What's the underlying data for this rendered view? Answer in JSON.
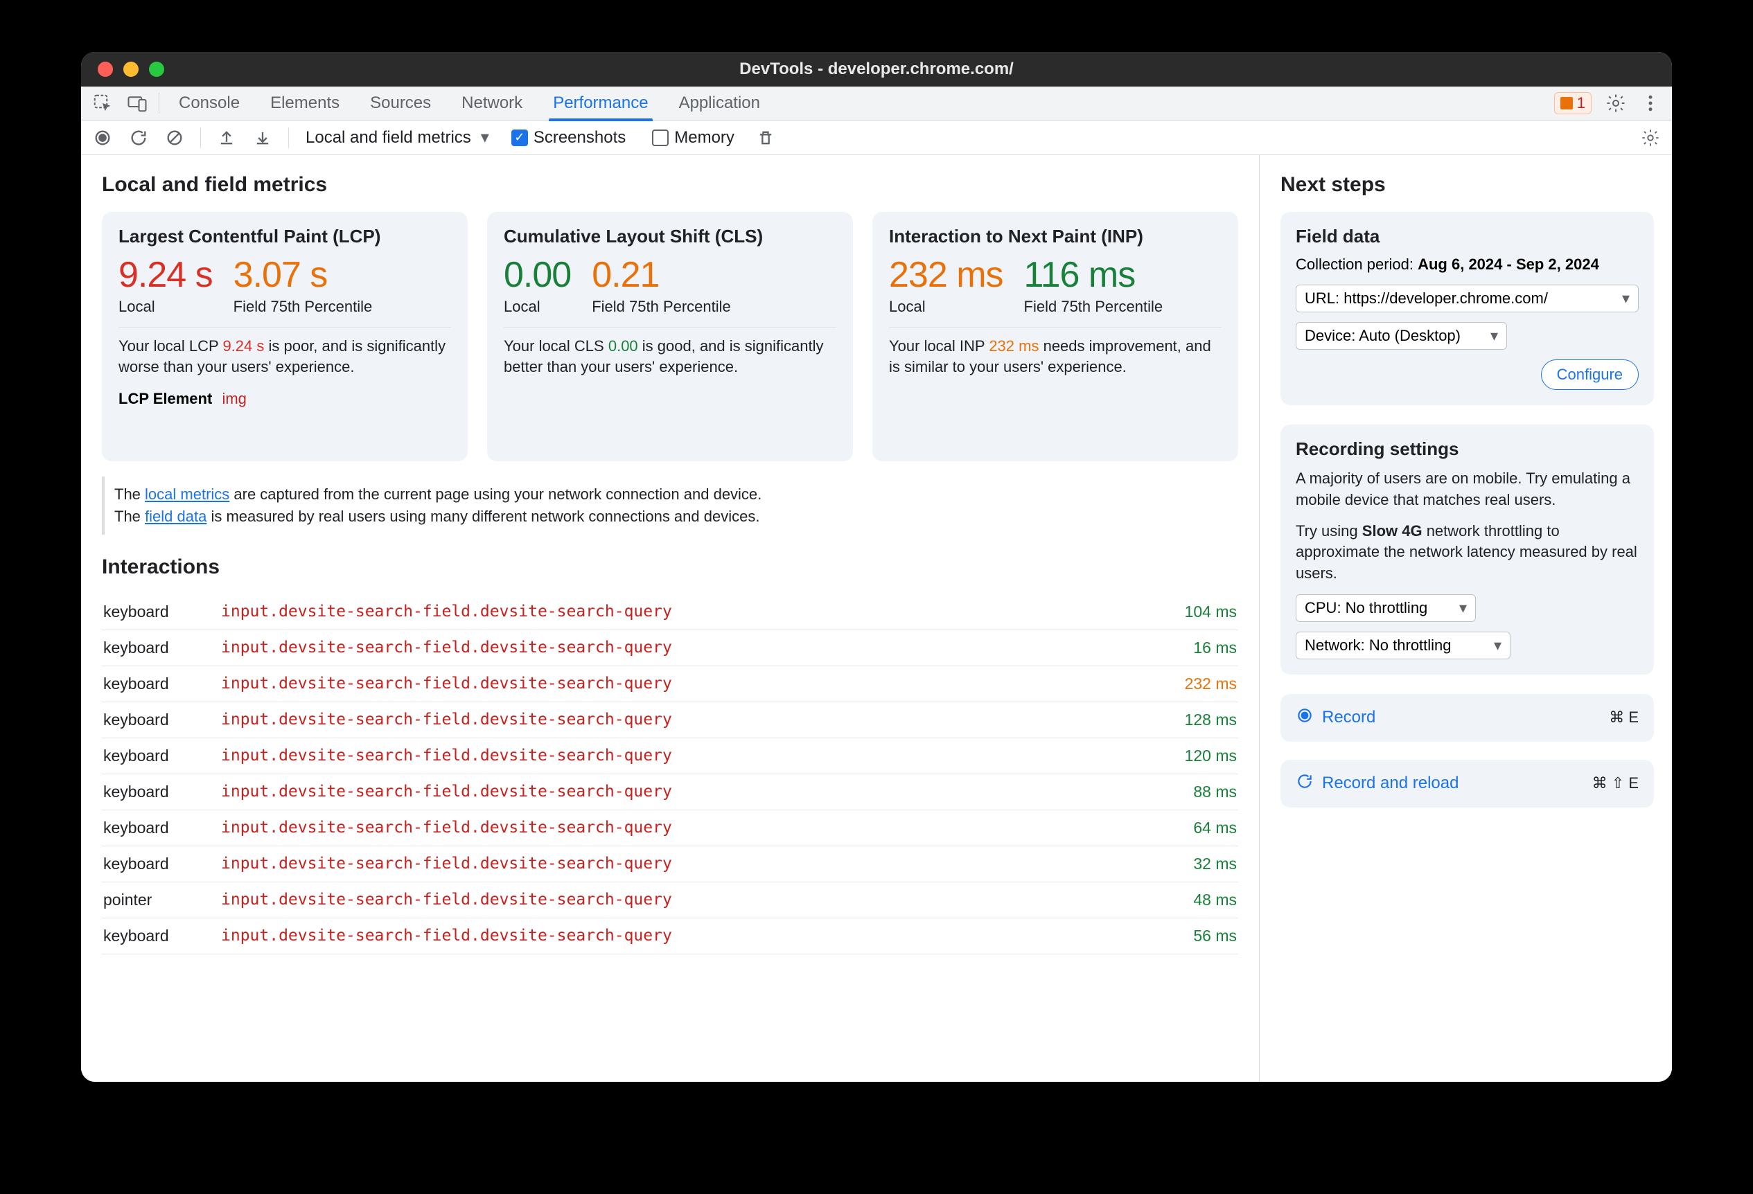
{
  "window": {
    "title": "DevTools - developer.chrome.com/"
  },
  "tabs": {
    "items": [
      "Console",
      "Elements",
      "Sources",
      "Network",
      "Performance",
      "Application"
    ],
    "active": "Performance",
    "issues_count": "1"
  },
  "toolbar": {
    "metrics_dropdown": "Local and field metrics",
    "screenshots": {
      "label": "Screenshots",
      "checked": true
    },
    "memory": {
      "label": "Memory",
      "checked": false
    }
  },
  "main": {
    "heading": "Local and field metrics",
    "cards": {
      "lcp": {
        "title": "Largest Contentful Paint (LCP)",
        "local_value": "9.24 s",
        "local_color": "red",
        "local_label": "Local",
        "field_value": "3.07 s",
        "field_color": "orange",
        "field_label": "Field 75th Percentile",
        "advice_pre": "Your local LCP ",
        "advice_val": "9.24 s",
        "advice_post": " is poor, and is significantly worse than your users' experience.",
        "lcp_element_label": "LCP Element",
        "lcp_element_tag": "img"
      },
      "cls": {
        "title": "Cumulative Layout Shift (CLS)",
        "local_value": "0.00",
        "local_color": "green",
        "local_label": "Local",
        "field_value": "0.21",
        "field_color": "orange",
        "field_label": "Field 75th Percentile",
        "advice_pre": "Your local CLS ",
        "advice_val": "0.00",
        "advice_post": " is good, and is significantly better than your users' experience."
      },
      "inp": {
        "title": "Interaction to Next Paint (INP)",
        "local_value": "232 ms",
        "local_color": "orange",
        "local_label": "Local",
        "field_value": "116 ms",
        "field_color": "green",
        "field_label": "Field 75th Percentile",
        "advice_pre": "Your local INP ",
        "advice_val": "232 ms",
        "advice_post": " needs improvement, and is similar to your users' experience."
      }
    },
    "note": {
      "line1a": "The ",
      "link1": "local metrics",
      "line1b": " are captured from the current page using your network connection and device.",
      "line2a": "The ",
      "link2": "field data",
      "line2b": " is measured by real users using many different network connections and devices."
    },
    "interactions_heading": "Interactions",
    "interactions": [
      {
        "type": "keyboard",
        "selector": "input.devsite-search-field.devsite-search-query",
        "duration": "104 ms",
        "color": "green"
      },
      {
        "type": "keyboard",
        "selector": "input.devsite-search-field.devsite-search-query",
        "duration": "16 ms",
        "color": "green"
      },
      {
        "type": "keyboard",
        "selector": "input.devsite-search-field.devsite-search-query",
        "duration": "232 ms",
        "color": "orange"
      },
      {
        "type": "keyboard",
        "selector": "input.devsite-search-field.devsite-search-query",
        "duration": "128 ms",
        "color": "green"
      },
      {
        "type": "keyboard",
        "selector": "input.devsite-search-field.devsite-search-query",
        "duration": "120 ms",
        "color": "green"
      },
      {
        "type": "keyboard",
        "selector": "input.devsite-search-field.devsite-search-query",
        "duration": "88 ms",
        "color": "green"
      },
      {
        "type": "keyboard",
        "selector": "input.devsite-search-field.devsite-search-query",
        "duration": "64 ms",
        "color": "green"
      },
      {
        "type": "keyboard",
        "selector": "input.devsite-search-field.devsite-search-query",
        "duration": "32 ms",
        "color": "green"
      },
      {
        "type": "pointer",
        "selector": "input.devsite-search-field.devsite-search-query",
        "duration": "48 ms",
        "color": "green"
      },
      {
        "type": "keyboard",
        "selector": "input.devsite-search-field.devsite-search-query",
        "duration": "56 ms",
        "color": "green"
      }
    ]
  },
  "aside": {
    "heading": "Next steps",
    "field_data": {
      "title": "Field data",
      "period_label": "Collection period: ",
      "period_value": "Aug 6, 2024 - Sep 2, 2024",
      "url_select": "URL: https://developer.chrome.com/",
      "device_select": "Device: Auto (Desktop)",
      "configure": "Configure"
    },
    "recording_settings": {
      "title": "Recording settings",
      "p1": "A majority of users are on mobile. Try emulating a mobile device that matches real users.",
      "p2a": "Try using ",
      "p2b": "Slow 4G",
      "p2c": " network throttling to approximate the network latency measured by real users.",
      "cpu_select": "CPU: No throttling",
      "net_select": "Network: No throttling"
    },
    "record": {
      "label": "Record",
      "shortcut": "⌘ E"
    },
    "record_reload": {
      "label": "Record and reload",
      "shortcut": "⌘ ⇧ E"
    }
  }
}
